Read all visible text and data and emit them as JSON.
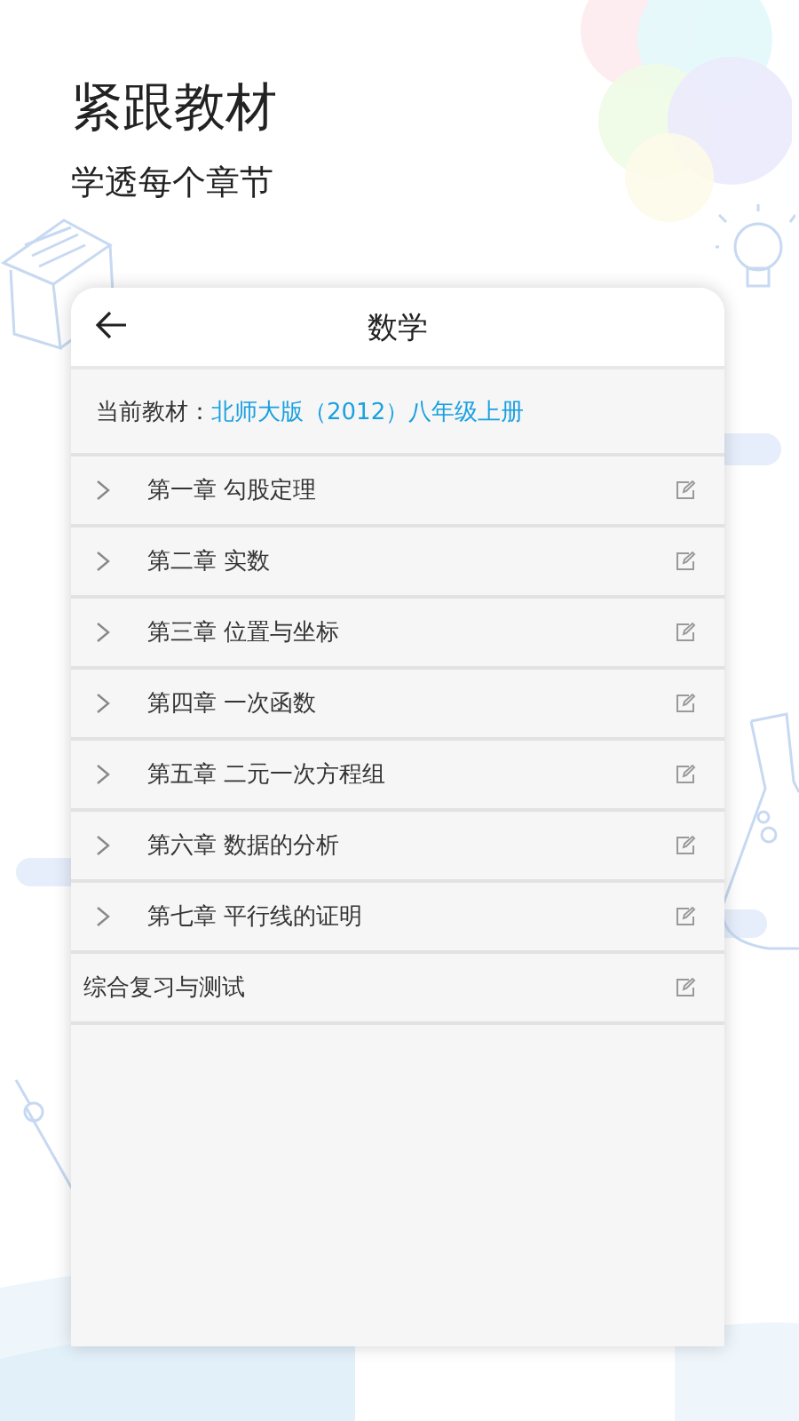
{
  "headline": "紧跟教材",
  "subtitle": "学透每个章节",
  "card": {
    "title": "数学",
    "textbook": {
      "label": "当前教材：",
      "value": "北师大版（2012）八年级上册"
    },
    "items": [
      {
        "kind": "chapter",
        "title": "第一章 勾股定理"
      },
      {
        "kind": "chapter",
        "title": "第二章 实数"
      },
      {
        "kind": "chapter",
        "title": "第三章 位置与坐标"
      },
      {
        "kind": "chapter",
        "title": "第四章 一次函数"
      },
      {
        "kind": "chapter",
        "title": "第五章 二元一次方程组"
      },
      {
        "kind": "chapter",
        "title": "第六章 数据的分析"
      },
      {
        "kind": "chapter",
        "title": "第七章 平行线的证明"
      },
      {
        "kind": "section",
        "title": "综合复习与测试"
      }
    ]
  }
}
